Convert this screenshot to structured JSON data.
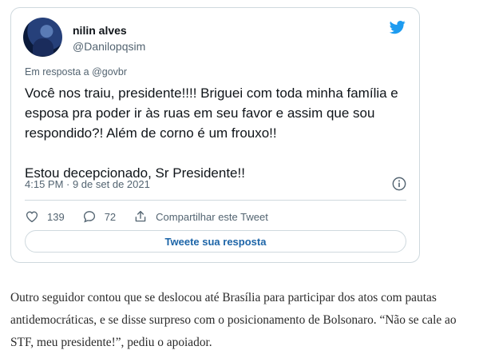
{
  "tweet": {
    "author_name": "nilin alves",
    "author_handle": "@Danilopqsim",
    "reply_to": "Em resposta a @govbr",
    "paragraphs": [
      "Você nos traiu, presidente!!!! Briguei com toda minha família e esposa pra poder ir às ruas em seu favor e assim que sou respondido?! Além de corno é um frouxo!!",
      "Estou decepcionado, Sr Presidente!!"
    ],
    "timestamp": "4:15 PM · 9 de set de 2021",
    "likes": "139",
    "replies": "72",
    "share_label": "Compartilhar este Tweet",
    "reply_button_label": "Tweete sua resposta",
    "icons": {
      "logo": "twitter-bird-icon",
      "info": "info-icon",
      "like": "heart-icon",
      "reply": "speech-bubble-icon",
      "share": "share-arrow-icon"
    },
    "colors": {
      "brand": "#1d9bf0",
      "link": "#1d65a8",
      "muted": "#536471",
      "border": "#cfd9de"
    }
  },
  "article": {
    "paragraph": "Outro seguidor contou que se deslocou até Brasília para participar dos atos com pautas antidemocráticas, e se disse surpreso com o posicionamento de Bolsonaro. “Não se cale ao STF, meu presidente!”, pediu o apoiador."
  }
}
